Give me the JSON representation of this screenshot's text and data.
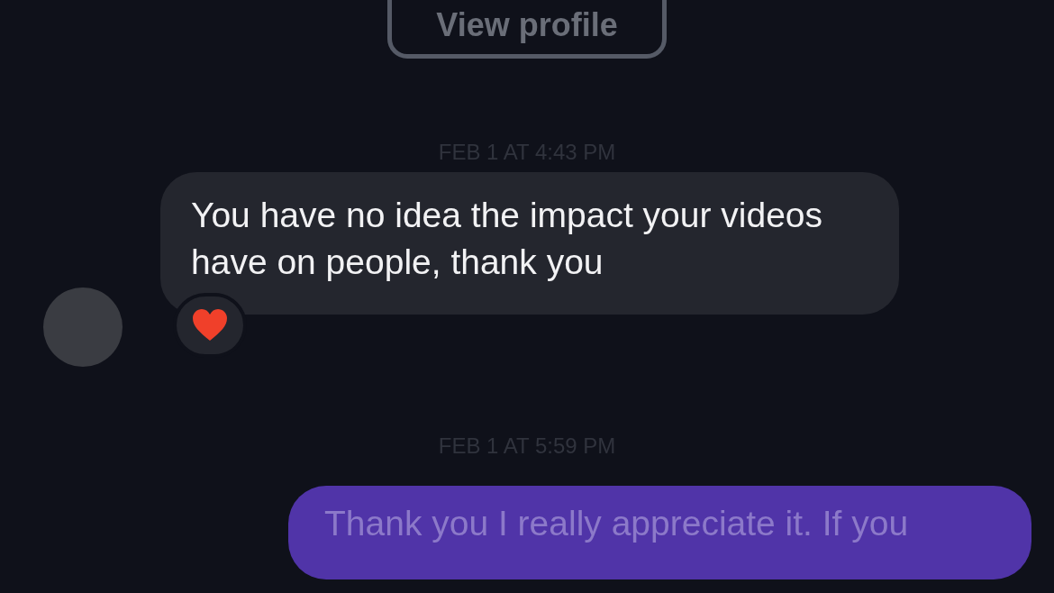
{
  "profile_button": {
    "label": "View profile"
  },
  "messages": [
    {
      "kind": "timestamp",
      "text": "FEB 1 AT 4:43 PM"
    },
    {
      "kind": "incoming",
      "text": "You have no idea the impact your videos have on people, thank you",
      "reacted": true
    },
    {
      "kind": "timestamp",
      "text": "FEB 1 AT 5:59 PM"
    },
    {
      "kind": "outgoing",
      "text": "Thank you I really appreciate it. If you"
    }
  ]
}
